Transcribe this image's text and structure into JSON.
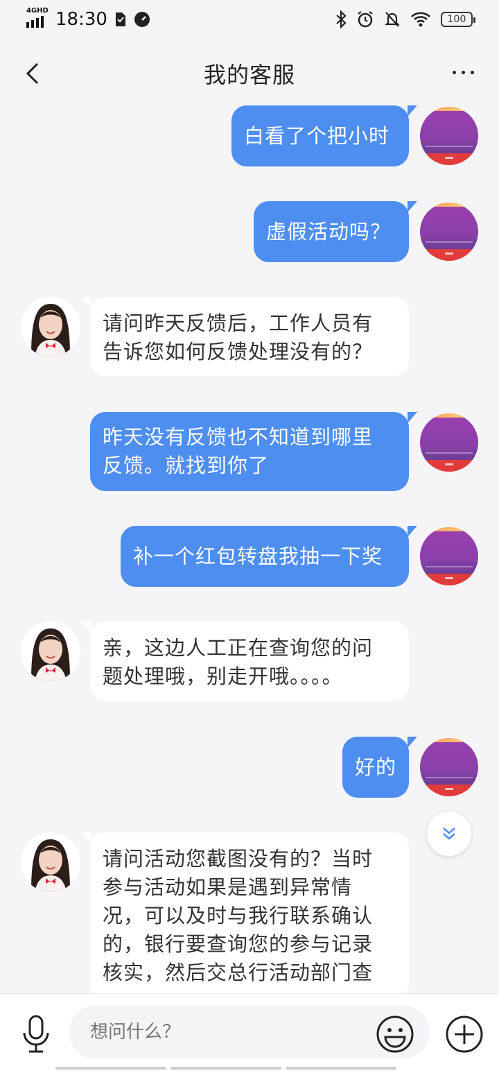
{
  "status_bar": {
    "network": "4GHD",
    "time": "18:30",
    "battery": "100",
    "icons": [
      "sim-card-icon",
      "speed-icon",
      "bluetooth-icon",
      "alarm-icon",
      "mute-icon",
      "wifi-icon",
      "battery-icon"
    ]
  },
  "header": {
    "title": "我的客服",
    "back_icon": "chevron-left-icon",
    "more_icon": "more-dots-icon"
  },
  "messages": [
    {
      "sender": "user",
      "lines": [
        "白看了个把小时"
      ]
    },
    {
      "sender": "user",
      "lines": [
        "虚假活动吗？"
      ]
    },
    {
      "sender": "agent",
      "lines": [
        "请问昨天反馈后，工作人员有",
        "告诉您如何反馈处理没有的？"
      ]
    },
    {
      "sender": "user",
      "lines": [
        "昨天没有反馈也不知道到哪里",
        "反馈。就找到你了"
      ]
    },
    {
      "sender": "user",
      "lines": [
        "补一个红包转盘我抽一下奖"
      ]
    },
    {
      "sender": "agent",
      "lines": [
        "亲，这边人工正在查询您的问",
        "题处理哦，别走开哦。。。。"
      ]
    },
    {
      "sender": "user",
      "lines": [
        "好的"
      ]
    },
    {
      "sender": "agent",
      "lines": [
        "请问活动您截图没有的？当时",
        "参与活动如果是遇到异常情",
        "况，可以及时与我行联系确认",
        "的，银行要查询您的参与记录",
        "核实，然后交总行活动部门查"
      ]
    }
  ],
  "scroll_down_icon": "double-chevron-down-icon",
  "input_bar": {
    "placeholder": "想问什么？",
    "mic_icon": "microphone-icon",
    "emoji_icon": "smiley-icon",
    "plus_icon": "plus-circle-icon"
  },
  "colors": {
    "user_bubble": "#4e8ef1",
    "agent_bubble": "#ffffff",
    "background": "#f5f5f7"
  }
}
